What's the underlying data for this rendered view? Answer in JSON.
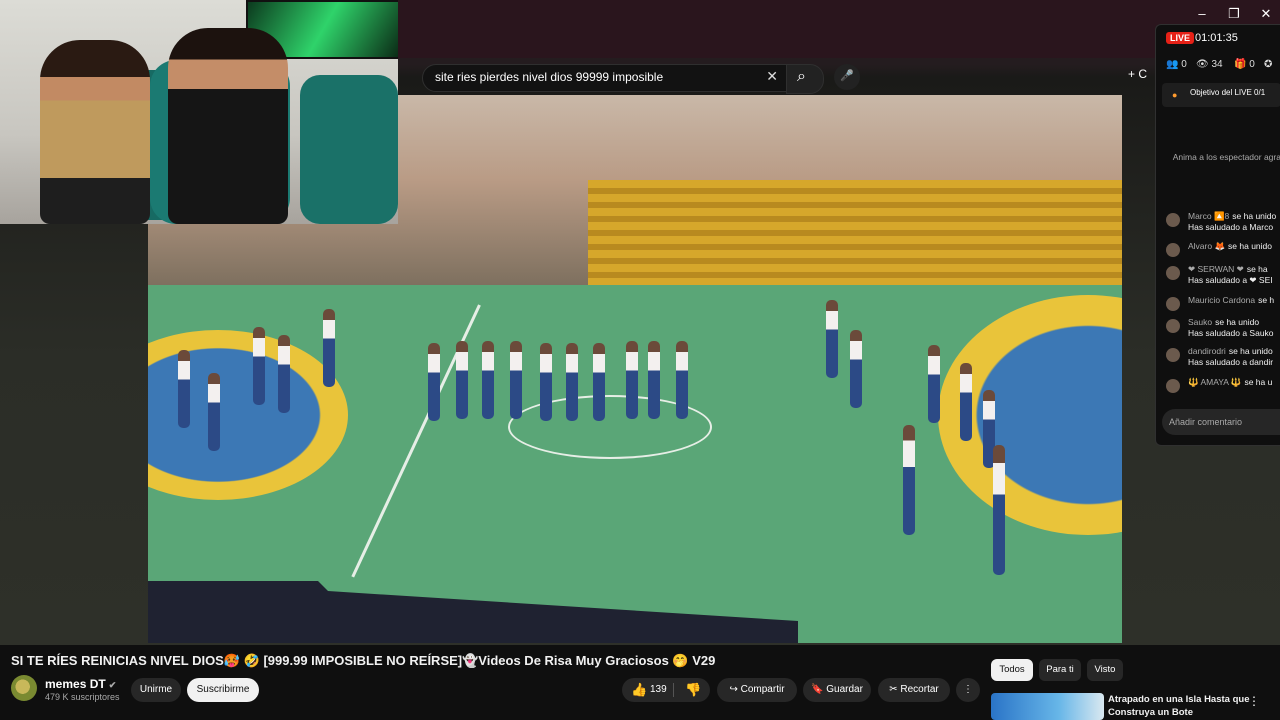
{
  "window": {
    "minimize": "–",
    "restore": "❐",
    "close": "✕"
  },
  "search": {
    "query": "site ries pierdes nivel dios 99999 imposible",
    "clear_icon": "✕",
    "search_icon": "⌕",
    "mic_icon": "🎤"
  },
  "header": {
    "create_label": "+ C"
  },
  "live_chat": {
    "live_badge": "LIVE",
    "elapsed": "01:01:35",
    "stats": [
      {
        "icon": "👥",
        "value": "0"
      },
      {
        "icon": "👁",
        "value": "34"
      },
      {
        "icon": "🎁",
        "value": "0"
      },
      {
        "icon": "✪",
        "value": ""
      }
    ],
    "goal": "Objetivo del LIVE 0/1",
    "hint": "Anima a los espectador agradécele",
    "messages": [
      {
        "user": "Marco 🔼8",
        "line1": "se ha unido",
        "line2": "Has saludado a Marco"
      },
      {
        "user": "Alvaro 🦊",
        "line1": "se ha unido",
        "line2": ""
      },
      {
        "user": "❤ SERWAN ❤",
        "line1": "se ha",
        "line2": "Has saludado a ❤ SEI"
      },
      {
        "user": "Mauricio Cardona",
        "line1": "se h",
        "line2": ""
      },
      {
        "user": "Sauko",
        "line1": "se ha unido",
        "line2": "Has saludado a Sauko"
      },
      {
        "user": "dandirodri",
        "line1": "se ha unido",
        "line2": "Has saludado a dandir"
      },
      {
        "user": "🔱 AMAYA 🔱",
        "line1": "se ha u",
        "line2": ""
      }
    ],
    "input_placeholder": "Añadir comentario"
  },
  "video": {
    "title": "SI TE RÍES REINICIAS NIVEL DIOS🥵 🤣 [999.99 IMPOSIBLE NO REÍRSE]👻Videos De Risa Muy Graciosos 🤭 V29"
  },
  "channel": {
    "name": "memes DT",
    "verified_icon": "✔",
    "subscribers": "479 K suscriptores",
    "join_label": "Unirme",
    "subscribe_label": "Suscribirme"
  },
  "actions": {
    "like_icon": "👍",
    "like_count": "139",
    "dislike_icon": "👎",
    "share_label": "↪ Compartir",
    "save_label": "🔖 Guardar",
    "clip_label": "✂ Recortar",
    "more_label": "⋮"
  },
  "sidebar_chips": [
    "Todos",
    "Para ti",
    "Visto"
  ],
  "recommendation": {
    "title": "Atrapado en una Isla Hasta que Construya un Bote",
    "more_icon": "⋮"
  }
}
